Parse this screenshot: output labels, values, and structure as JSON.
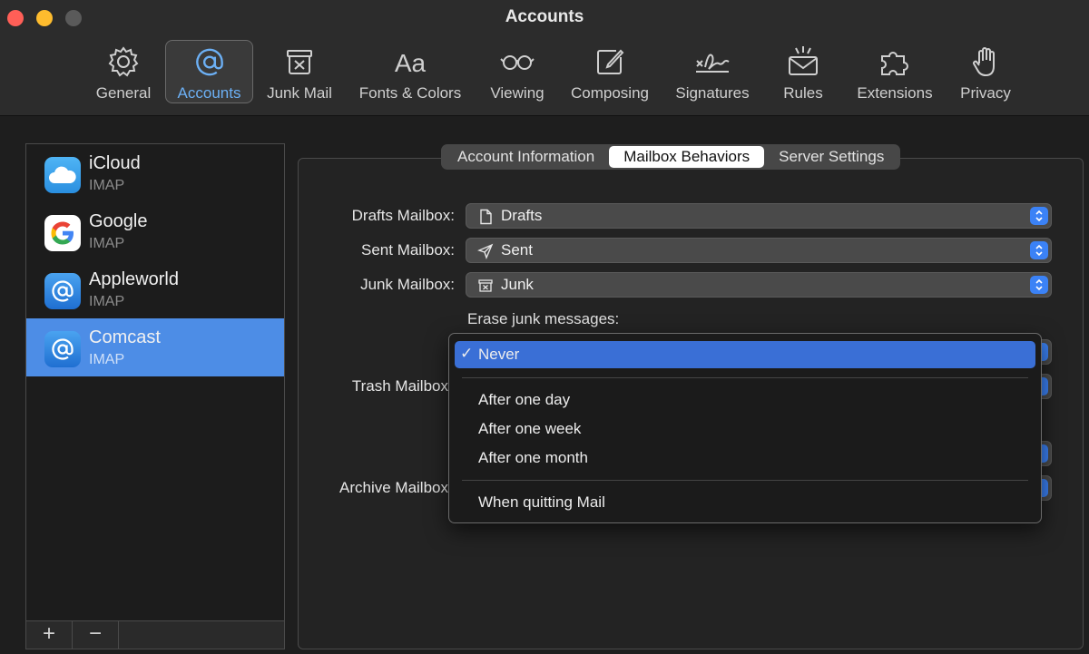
{
  "window": {
    "title": "Accounts"
  },
  "toolbar": [
    {
      "label": "General",
      "icon": "gear-icon"
    },
    {
      "label": "Accounts",
      "icon": "at-sign-icon",
      "active": true
    },
    {
      "label": "Junk Mail",
      "icon": "junk-bin-icon"
    },
    {
      "label": "Fonts & Colors",
      "icon": "font-aa-icon"
    },
    {
      "label": "Viewing",
      "icon": "glasses-icon"
    },
    {
      "label": "Composing",
      "icon": "compose-icon"
    },
    {
      "label": "Signatures",
      "icon": "signature-icon"
    },
    {
      "label": "Rules",
      "icon": "rules-envelope-icon"
    },
    {
      "label": "Extensions",
      "icon": "puzzle-icon"
    },
    {
      "label": "Privacy",
      "icon": "hand-icon"
    }
  ],
  "accounts": [
    {
      "name": "iCloud",
      "type": "IMAP",
      "icon": "icloud-icon"
    },
    {
      "name": "Google",
      "type": "IMAP",
      "icon": "google-icon"
    },
    {
      "name": "Appleworld",
      "type": "IMAP",
      "icon": "at-sign-icon"
    },
    {
      "name": "Comcast",
      "type": "IMAP",
      "icon": "at-sign-icon",
      "selected": true
    }
  ],
  "sidebar_buttons": {
    "add": "+",
    "remove": "−"
  },
  "tabs": [
    {
      "label": "Account Information"
    },
    {
      "label": "Mailbox Behaviors",
      "active": true
    },
    {
      "label": "Server Settings"
    }
  ],
  "fields": {
    "drafts": {
      "label": "Drafts Mailbox:",
      "value": "Drafts",
      "icon": "document-icon"
    },
    "sent": {
      "label": "Sent Mailbox:",
      "value": "Sent",
      "icon": "paper-plane-icon"
    },
    "junk": {
      "label": "Junk Mailbox:",
      "value": "Junk",
      "icon": "junk-bin-icon"
    },
    "erase_junk_label": "Erase junk messages:",
    "trash": {
      "label": "Trash Mailbox"
    },
    "archive": {
      "label": "Archive Mailbox"
    }
  },
  "erase_menu": {
    "selected": "Never",
    "options": [
      "Never",
      "After one day",
      "After one week",
      "After one month",
      "When quitting Mail"
    ]
  },
  "colors": {
    "accent": "#3b82f6",
    "selection": "#4d8de6",
    "menu_highlight": "#3a6fd6"
  }
}
